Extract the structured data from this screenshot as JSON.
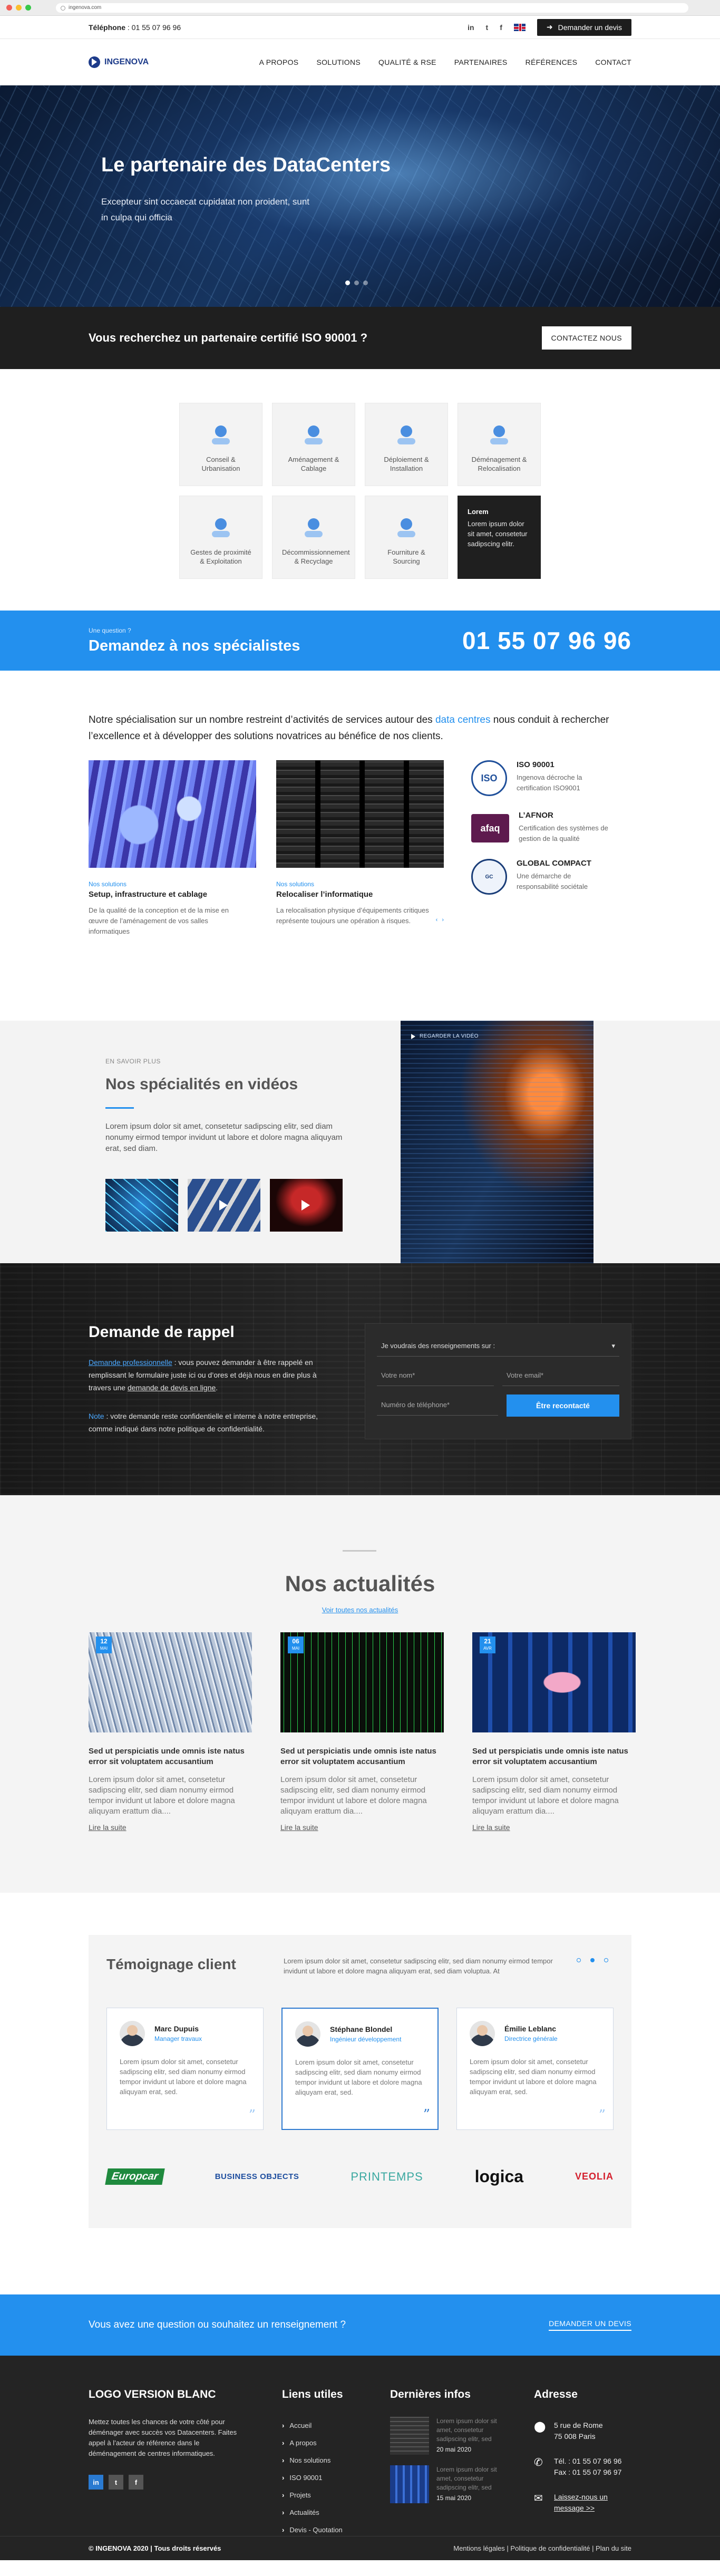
{
  "browser": {
    "url": "ingenova.com"
  },
  "topbar": {
    "phone_label": "Téléphone",
    "phone_value": ": 01 55 07 96 96",
    "social": [
      "in",
      "t",
      "f"
    ],
    "devis_button": "Demander un devis"
  },
  "nav": {
    "logo_text": "INGENOVA",
    "menu": [
      "A PROPOS",
      "SOLUTIONS",
      "QUALITÉ & RSE",
      "PARTENAIRES",
      "RÉFÉRENCES",
      "CONTACT"
    ]
  },
  "hero": {
    "title": "Le partenaire des DataCenters",
    "subtitle": "Excepteur sint occaecat cupidatat non proident, sunt in culpa qui officia",
    "slides": 3,
    "active_slide": 1
  },
  "iso_band": {
    "text": "Vous recherchez un partenaire certifié ISO 90001 ?",
    "button": "CONTACTEZ NOUS"
  },
  "services": [
    {
      "label": "Conseil & Urbanisation",
      "icon": "consulting-icon"
    },
    {
      "label": "Aménagement & Cablage",
      "icon": "cabling-icon"
    },
    {
      "label": "Déploiement & Installation",
      "icon": "deployment-icon"
    },
    {
      "label": "Déménagement & Relocalisation",
      "icon": "moving-icon"
    },
    {
      "label": "Gestes de proximité & Exploitation",
      "icon": "proximity-icon"
    },
    {
      "label": "Décommissionnement & Recyclage",
      "icon": "recycling-icon"
    },
    {
      "label": "Fourniture & Sourcing",
      "icon": "sourcing-icon"
    }
  ],
  "service_highlight": {
    "title": "Lorem",
    "body": "Lorem ipsum dolor sit amet, consetetur sadipscing elitr."
  },
  "phone_band": {
    "small": "Une question ?",
    "title": "Demandez à nos spécialistes",
    "phone": "01 55 07 96 96"
  },
  "specialisation": {
    "intro_before": "Notre spécialisation sur un nombre restreint d’activités de services autour des",
    "intro_highlight": "data centres",
    "intro_after": "nous conduit à rechercher l’excellence et à développer des solutions novatrices au bénéfice de nos clients.",
    "cards": [
      {
        "tag": "Nos solutions",
        "title": "Setup, infrastructure et cablage",
        "text": "De la qualité de la conception et de la mise en œuvre de l’aménagement de vos salles informatiques"
      },
      {
        "tag": "Nos solutions",
        "title": "Relocaliser l’informatique",
        "text": "La relocalisation physique d’équipements critiques représente toujours une opération à risques."
      }
    ],
    "arrows": [
      "‹",
      "›"
    ],
    "certs": [
      {
        "logo": "ISO",
        "title": "ISO 90001",
        "text": "Ingenova décroche la certification ISO9001"
      },
      {
        "logo": "afaq",
        "title": "L’AFNOR",
        "text": "Certification des systèmes de gestion de la qualité"
      },
      {
        "logo": "GC",
        "title": "GLOBAL COMPACT",
        "text": "Une démarche de responsabilité sociétale"
      }
    ]
  },
  "videos": {
    "small": "EN SAVOIR PLUS",
    "title": "Nos spécialités en vidéos",
    "text": "Lorem ipsum dolor sit amet, consetetur sadipscing elitr, sed diam nonumy eirmod tempor invidunt ut labore et dolore magna aliquyam erat, sed diam.",
    "player_label": "REGARDER LA VIDÉO"
  },
  "callback": {
    "title": "Demande de rappel",
    "p1_highlight": "Demande professionnelle",
    "p1_text": " : vous pouvez demander à être rappelé en remplissant le formulaire juste ici ou d’ores et déjà nous en dire plus à travers une ",
    "p1_link": "demande de devis en ligne",
    "p1_end": ".",
    "p2_highlight": "Note",
    "p2_text": " : votre demande reste confidentielle et interne à notre entreprise, comme indiqué dans notre politique de confidentialité.",
    "select_placeholder": "Je voudrais des renseignements sur :",
    "name_placeholder": "Votre nom*",
    "email_placeholder": "Votre email*",
    "phone_placeholder": "Numéro de téléphone*",
    "submit": "Être recontacté"
  },
  "news": {
    "title": "Nos actualités",
    "all_link": "Voir toutes nos actualités",
    "cards": [
      {
        "day": "12",
        "month": "MAI",
        "title": "Sed ut perspiciatis unde omnis iste natus error sit voluptatem accusantium",
        "text": "Lorem ipsum dolor sit amet, consetetur sadipscing elitr, sed diam nonumy eirmod tempor invidunt ut labore et dolore magna aliquyam erattum dia....",
        "more": "Lire la suite"
      },
      {
        "day": "06",
        "month": "MAI",
        "title": "Sed ut perspiciatis unde omnis iste natus error sit voluptatem accusantium",
        "text": "Lorem ipsum dolor sit amet, consetetur sadipscing elitr, sed diam nonumy eirmod tempor invidunt ut labore et dolore magna aliquyam erattum dia....",
        "more": "Lire la suite"
      },
      {
        "day": "21",
        "month": "AVR",
        "title": "Sed ut perspiciatis unde omnis iste natus error sit voluptatem accusantium",
        "text": "Lorem ipsum dolor sit amet, consetetur sadipscing elitr, sed diam nonumy eirmod tempor invidunt ut labore et dolore magna aliquyam erattum dia....",
        "more": "Lire la suite"
      }
    ]
  },
  "testimonials": {
    "title": "Témoignage client",
    "text": "Lorem ipsum dolor sit amet, consetetur sadipscing elitr, sed diam nonumy eirmod tempor invidunt ut labore et dolore magna aliquyam erat, sed diam voluptua. At",
    "dots": 3,
    "active_dot": 2,
    "cards": [
      {
        "name": "Marc Dupuis",
        "role": "Manager travaux",
        "text": "Lorem ipsum dolor sit amet, consetetur sadipscing elitr, sed diam nonumy eirmod tempor invidunt ut labore et dolore magna aliquyam erat, sed."
      },
      {
        "name": "Stéphane Blondel",
        "role": "Ingénieur développement",
        "text": "Lorem ipsum dolor sit amet, consetetur sadipscing elitr, sed diam nonumy eirmod tempor invidunt ut labore et dolore magna aliquyam erat, sed."
      },
      {
        "name": "Émilie Leblanc",
        "role": "Directrice générale",
        "text": "Lorem ipsum dolor sit amet, consetetur sadipscing elitr, sed diam nonumy eirmod tempor invidunt ut labore et dolore magna aliquyam erat, sed."
      }
    ],
    "clients": [
      "Europcar",
      "BUSINESS OBJECTS",
      "PRINTEMPS",
      "logica",
      "VEOLIA"
    ]
  },
  "question_band": {
    "text": "Vous avez une question ou souhaitez un renseignement ?",
    "link": "DEMANDER UN DEVIS"
  },
  "footer": {
    "col1_title": "LOGO VERSION BLANC",
    "col1_text": "Mettez toutes les chances de votre côté pour déménager avec succès vos Datacenters. Faites appel à l’acteur de référence dans le déménagement de centres informatiques.",
    "social": [
      "in",
      "t",
      "f"
    ],
    "col2_title": "Liens utiles",
    "links": [
      "Accueil",
      "A propos",
      "Nos solutions",
      "ISO 90001",
      "Projets",
      "Actualités",
      "Devis - Quotation"
    ],
    "col3_title": "Dernières infos",
    "infos": [
      {
        "text": "Lorem ipsum dolor sit amet, consetetur sadipscing elitr, sed",
        "date": "20 mai 2020"
      },
      {
        "text": "Lorem ipsum dolor sit amet, consetetur sadipscing elitr, sed",
        "date": "15 mai 2020"
      }
    ],
    "col4_title": "Adresse",
    "address_line1": "5 rue de Rome",
    "address_line2": "75 008 Paris",
    "tel": "Tél. : 01 55 07 96 96",
    "fax": "Fax : 01 55 07 96 97",
    "message_link": "Laissez-nous un message >>",
    "copyright": "© INGENOVA 2020 | Tous droits réservés",
    "legal": "Mentions légales | Politique de confidentialité | Plan du site"
  },
  "colors": {
    "accent": "#2390ee",
    "dark": "#1f1f1f"
  }
}
